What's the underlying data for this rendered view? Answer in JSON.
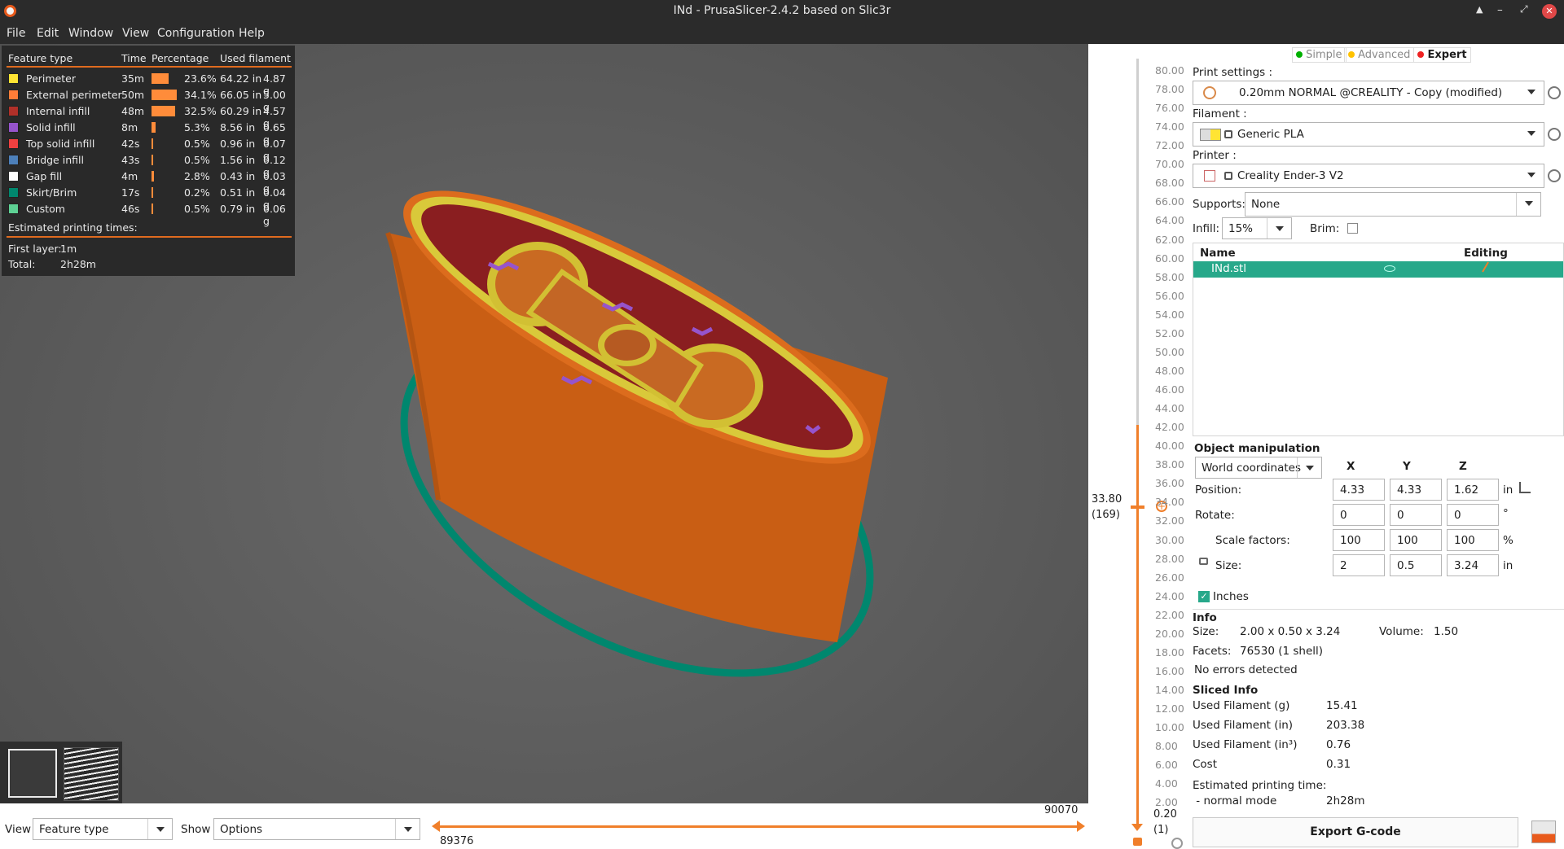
{
  "window": {
    "title": "INd - PrusaSlicer-2.4.2 based on Slic3r",
    "controls": [
      "▲",
      "–",
      "⤢",
      "✕"
    ]
  },
  "menu": [
    "File",
    "Edit",
    "Window",
    "View",
    "Configuration",
    "Help"
  ],
  "legend": {
    "headers": [
      "Feature type",
      "Time",
      "Percentage",
      "Used filament"
    ],
    "rows": [
      {
        "name": "Perimeter",
        "time": "35m",
        "pct": "23.6%",
        "len": "64.22 in",
        "wt": "4.87 g",
        "color": "#ffe433",
        "frac": 0.236
      },
      {
        "name": "External perimeter",
        "time": "50m",
        "pct": "34.1%",
        "len": "66.05 in",
        "wt": "5.00 g",
        "color": "#ff7d38",
        "frac": 0.341
      },
      {
        "name": "Internal infill",
        "time": "48m",
        "pct": "32.5%",
        "len": "60.29 in",
        "wt": "4.57 g",
        "color": "#b03029",
        "frac": 0.325
      },
      {
        "name": "Solid infill",
        "time": "8m",
        "pct": "5.3%",
        "len": "8.56 in",
        "wt": "0.65 g",
        "color": "#9654cc",
        "frac": 0.053
      },
      {
        "name": "Top solid infill",
        "time": "42s",
        "pct": "0.5%",
        "len": "0.96 in",
        "wt": "0.07 g",
        "color": "#f04040",
        "frac": 0.005
      },
      {
        "name": "Bridge infill",
        "time": "43s",
        "pct": "0.5%",
        "len": "1.56 in",
        "wt": "0.12 g",
        "color": "#4d80ba",
        "frac": 0.005
      },
      {
        "name": "Gap fill",
        "time": "4m",
        "pct": "2.8%",
        "len": "0.43 in",
        "wt": "0.03 g",
        "color": "#ffffff",
        "frac": 0.028
      },
      {
        "name": "Skirt/Brim",
        "time": "17s",
        "pct": "0.2%",
        "len": "0.51 in",
        "wt": "0.04 g",
        "color": "#00876e",
        "frac": 0.002
      },
      {
        "name": "Custom",
        "time": "46s",
        "pct": "0.5%",
        "len": "0.79 in",
        "wt": "0.06 g",
        "color": "#5ed194",
        "frac": 0.005
      }
    ],
    "est_label": "Estimated printing times:",
    "first_layer_label": "First layer:",
    "first_layer": "1m",
    "total_label": "Total:",
    "total": "2h28m"
  },
  "bottom": {
    "view_label": "View",
    "view_value": "Feature type",
    "show_label": "Show",
    "show_value": "Options",
    "h_left": "89376",
    "h_right": "90070"
  },
  "vslider": {
    "ticks": [
      "80.00",
      "78.00",
      "76.00",
      "74.00",
      "72.00",
      "70.00",
      "68.00",
      "66.00",
      "64.00",
      "62.00",
      "60.00",
      "58.00",
      "56.00",
      "54.00",
      "52.00",
      "50.00",
      "48.00",
      "46.00",
      "44.00",
      "42.00",
      "40.00",
      "38.00",
      "36.00",
      "34.00",
      "32.00",
      "30.00",
      "28.00",
      "26.00",
      "24.00",
      "22.00",
      "20.00",
      "18.00",
      "16.00",
      "14.00",
      "12.00",
      "10.00",
      "8.00",
      "6.00",
      "4.00",
      "2.00"
    ],
    "top_value": "33.80",
    "top_layer": "(169)",
    "bottom_value": "0.20",
    "bottom_layer": "(1)"
  },
  "modes": {
    "simple": "Simple",
    "advanced": "Advanced",
    "expert": "Expert",
    "simple_color": "#00b000",
    "advanced_color": "#ffc200",
    "expert_color": "#e22"
  },
  "print": {
    "label": "Print settings :",
    "value": "0.20mm NORMAL @CREALITY - Copy (modified)"
  },
  "filament": {
    "label": "Filament :",
    "value": "Generic PLA"
  },
  "printer": {
    "label": "Printer :",
    "value": "Creality Ender-3 V2"
  },
  "supports": {
    "label": "Supports:",
    "value": "None"
  },
  "infill": {
    "label": "Infill:",
    "value": "15%"
  },
  "brim": {
    "label": "Brim:"
  },
  "objects": {
    "col_name": "Name",
    "col_editing": "Editing",
    "rows": [
      {
        "name": "INd.stl"
      }
    ]
  },
  "manip": {
    "title": "Object manipulation",
    "coords": "World coordinates",
    "axes": [
      "X",
      "Y",
      "Z"
    ],
    "position": {
      "label": "Position:",
      "x": "4.33",
      "y": "4.33",
      "z": "1.62",
      "unit": "in"
    },
    "rotate": {
      "label": "Rotate:",
      "x": "0",
      "y": "0",
      "z": "0",
      "unit": "°"
    },
    "scale": {
      "label": "Scale factors:",
      "x": "100",
      "y": "100",
      "z": "100",
      "unit": "%"
    },
    "size": {
      "label": "Size:",
      "x": "2",
      "y": "0.5",
      "z": "3.24",
      "unit": "in"
    },
    "inches": "Inches"
  },
  "info": {
    "title": "Info",
    "size_label": "Size:",
    "size": "2.00 x 0.50 x 3.24",
    "volume_label": "Volume:",
    "volume": "1.50",
    "facets_label": "Facets:",
    "facets": "76530 (1 shell)",
    "errors": "No errors detected"
  },
  "sliced": {
    "title": "Sliced Info",
    "rows": [
      {
        "label": "Used Filament (g)",
        "value": "15.41"
      },
      {
        "label": "Used Filament (in)",
        "value": "203.38"
      },
      {
        "label": "Used Filament (in³)",
        "value": "0.76"
      },
      {
        "label": "Cost",
        "value": "0.31"
      }
    ],
    "est_label": "Estimated printing time:",
    "mode_label": " - normal mode",
    "mode_value": "2h28m"
  },
  "export": "Export G-code"
}
